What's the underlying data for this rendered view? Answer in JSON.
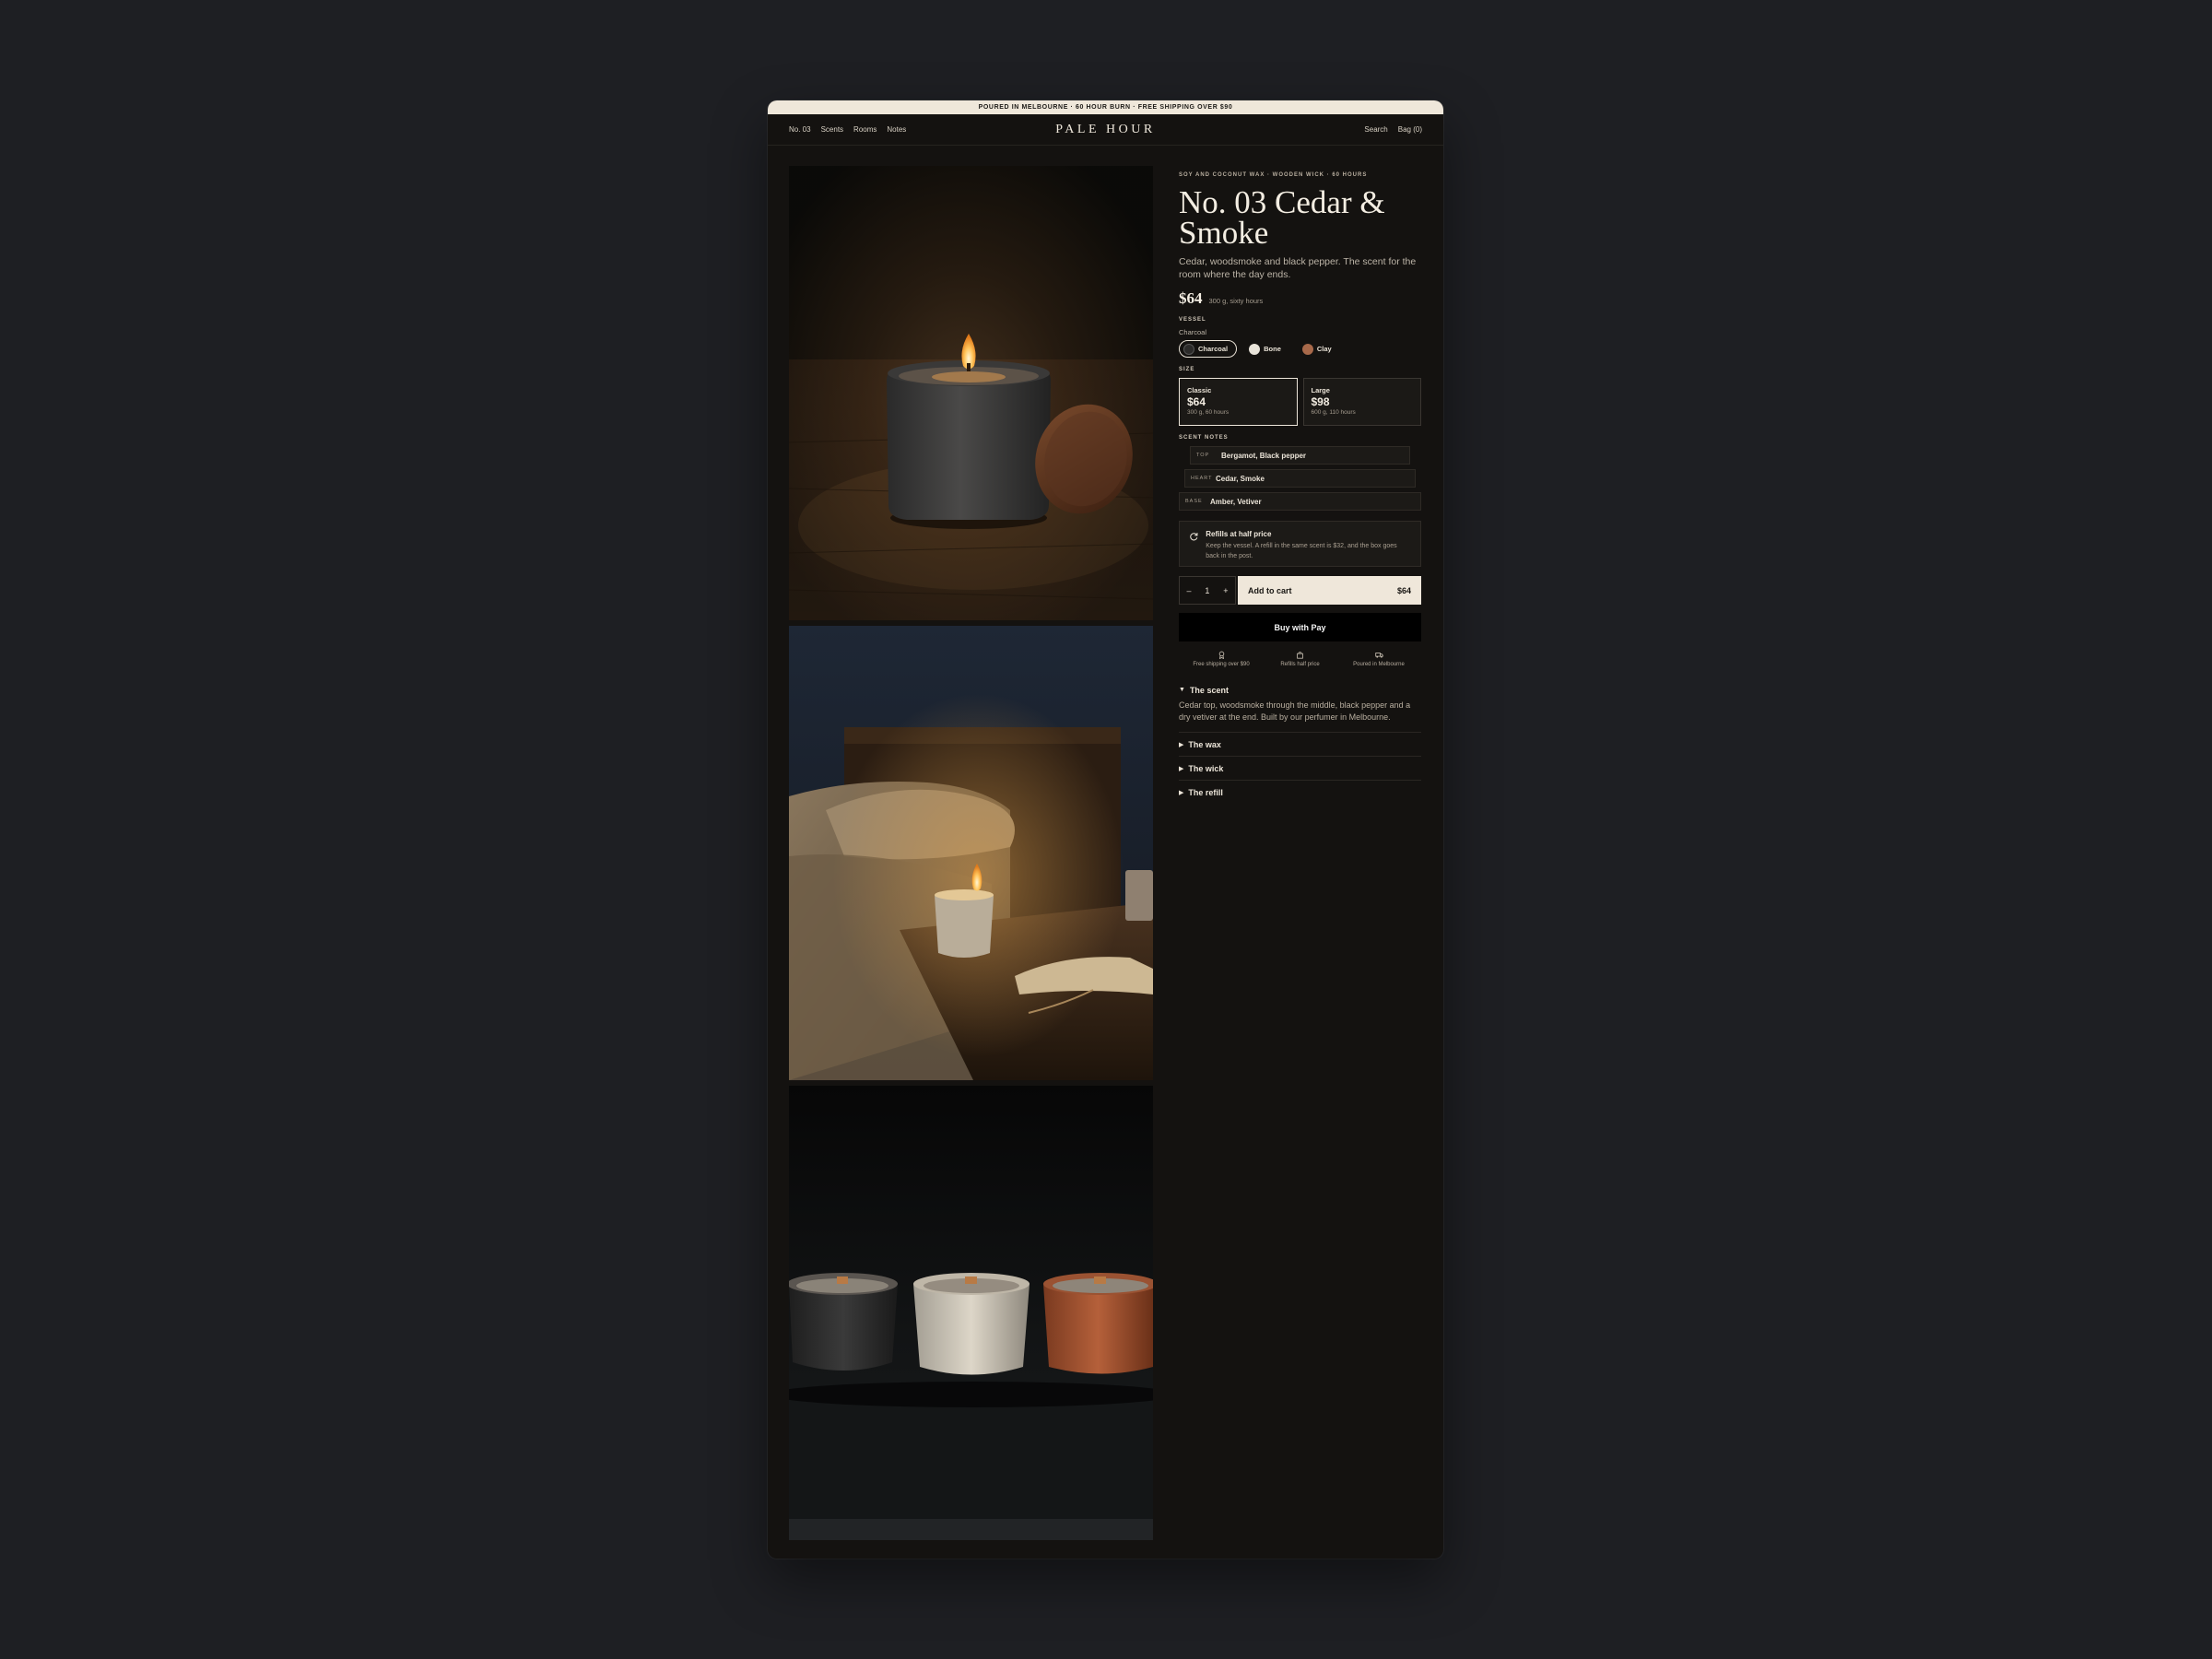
{
  "announcement": "POURED IN MELBOURNE · 60 HOUR BURN · FREE SHIPPING OVER $90",
  "nav": {
    "left": [
      "No. 03",
      "Scents",
      "Rooms",
      "Notes"
    ],
    "brand": "PALE HOUR",
    "search": "Search",
    "bag": "Bag (0)"
  },
  "product": {
    "eyebrow": "SOY AND COCONUT WAX · WOODEN WICK · 60 HOURS",
    "title": "No. 03 Cedar & Smoke",
    "description": "Cedar, woodsmoke and black pepper. The scent for the room where the day ends.",
    "price": "$64",
    "price_sub": "300 g, sixty hours"
  },
  "vessel": {
    "label": "VESSEL",
    "selected": "Charcoal",
    "options": [
      {
        "name": "Charcoal",
        "color": "#2b2a29"
      },
      {
        "name": "Bone",
        "color": "#e9e4da"
      },
      {
        "name": "Clay",
        "color": "#a8694a"
      }
    ]
  },
  "size": {
    "label": "SIZE",
    "options": [
      {
        "name": "Classic",
        "price": "$64",
        "sub": "300 g, 60 hours"
      },
      {
        "name": "Large",
        "price": "$98",
        "sub": "600 g, 110 hours"
      }
    ]
  },
  "notes": {
    "label": "SCENT NOTES",
    "rows": [
      {
        "k": "TOP",
        "v": "Bergamot, Black pepper"
      },
      {
        "k": "HEART",
        "v": "Cedar, Smoke"
      },
      {
        "k": "BASE",
        "v": "Amber, Vetiver"
      }
    ]
  },
  "refill": {
    "title": "Refills at half price",
    "text": "Keep the vessel. A refill in the same scent is $32, and the box goes back in the post."
  },
  "cart": {
    "minus": "–",
    "qty": "1",
    "plus": "+",
    "add_label": "Add to cart",
    "add_price": "$64",
    "apple_pay": "Buy with  Pay"
  },
  "perks": [
    "Free shipping over $90",
    "Refills half price",
    "Poured in Melbourne"
  ],
  "accordion": [
    {
      "title": "The scent",
      "open": true,
      "body": "Cedar top, woodsmoke through the middle, black pepper and a dry vetiver at the end. Built by our perfumer in Melbourne."
    },
    {
      "title": "The wax",
      "open": false
    },
    {
      "title": "The wick",
      "open": false
    },
    {
      "title": "The refill",
      "open": false
    }
  ],
  "colors": {
    "accent": "#efe7da",
    "page": "#141210",
    "backdrop": "#1e1f23"
  }
}
